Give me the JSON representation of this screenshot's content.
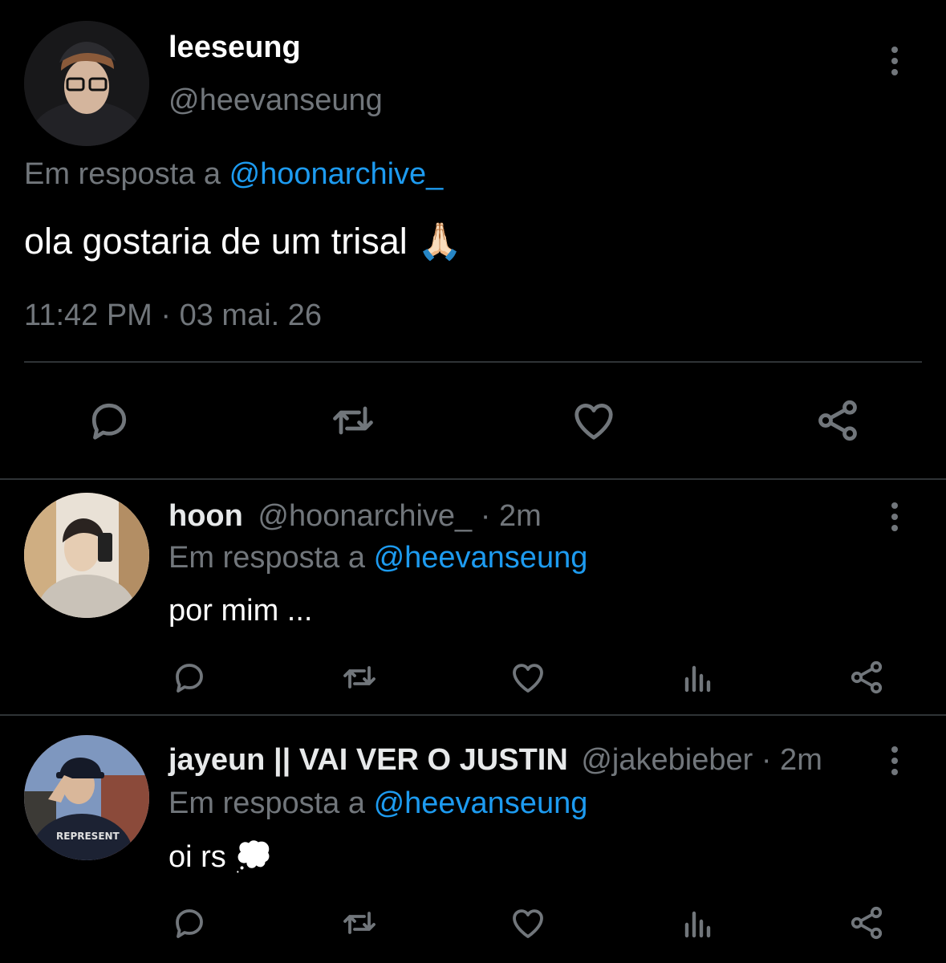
{
  "main_tweet": {
    "name": "leeseung",
    "handle": "@heevanseung",
    "reply_prefix": "Em resposta a",
    "reply_to": "@hoonarchive_",
    "text": "ola gostaria de um trisal 🙏🏻",
    "timestamp": "11:42 PM · 03 mai. 26",
    "actions": [
      "reply-icon",
      "retweet-icon",
      "like-icon",
      "share-icon"
    ]
  },
  "replies": [
    {
      "name": "hoon",
      "handle": "@hoonarchive_",
      "time": "· 2m",
      "reply_prefix": "Em resposta a",
      "reply_to": "@heevanseung",
      "text": "por mim ...",
      "actions": [
        "reply-icon",
        "retweet-icon",
        "like-icon",
        "views-icon",
        "share-icon"
      ]
    },
    {
      "name": "jayeun || VAI VER O JUSTIN",
      "handle": "@jakebieber",
      "time": "· 2m",
      "reply_prefix": "Em resposta a",
      "reply_to": "@heevanseung",
      "text": "oi rs 💭",
      "actions": [
        "reply-icon",
        "retweet-icon",
        "like-icon",
        "views-icon",
        "share-icon"
      ]
    }
  ],
  "colors": {
    "background": "#000000",
    "text": "#e7e9ea",
    "muted": "#71767b",
    "link": "#1d9bf0",
    "divider": "#2f3336"
  }
}
